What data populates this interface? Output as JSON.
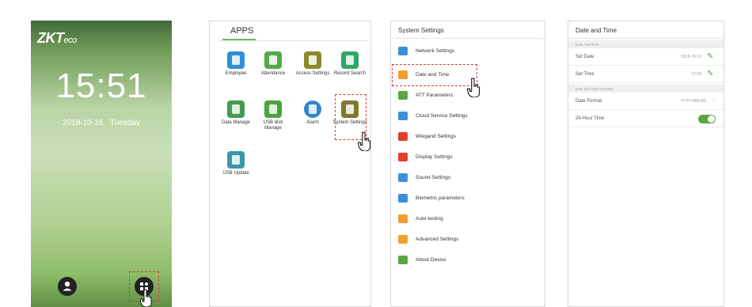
{
  "lock_screen": {
    "logo_main": "ZKT",
    "logo_sub": "eco",
    "time": "15:51",
    "date": "2018-10-16",
    "weekday": "Tuesday",
    "user_button_icon": "user-icon",
    "apps_button_icon": "apps-grid-icon"
  },
  "apps_screen": {
    "title": "APPS",
    "apps": [
      {
        "label": "Employee",
        "icon": "employee-icon",
        "color": "#2e8fd6"
      },
      {
        "label": "Attendance",
        "icon": "attendance-icon",
        "color": "#55a84a"
      },
      {
        "label": "Access Settings",
        "icon": "access-settings-icon",
        "color": "#8a8a2a"
      },
      {
        "label": "Record Search",
        "icon": "record-search-icon",
        "color": "#2fa66b"
      },
      {
        "label": "Data Manage",
        "icon": "data-manage-icon",
        "color": "#3f9e52"
      },
      {
        "label": "USB disk Manage",
        "icon": "usb-disk-icon",
        "color": "#4ea33e"
      },
      {
        "label": "Alarm",
        "icon": "alarm-icon",
        "color": "#2f86d0"
      },
      {
        "label": "System Settings",
        "icon": "gear-icon",
        "color": "#7e7a2c"
      },
      {
        "label": "USB Update",
        "icon": "usb-update-icon",
        "color": "#3b98a8"
      }
    ]
  },
  "settings_screen": {
    "title": "System Settings",
    "items": [
      {
        "label": "Network Settings",
        "icon": "network-icon",
        "color": "#3b8fd8"
      },
      {
        "label": "Date and Time",
        "icon": "calendar-icon",
        "color": "#f0a030"
      },
      {
        "label": "ATT Parameters",
        "icon": "att-icon",
        "color": "#5aa642"
      },
      {
        "label": "Cloud Service Settings",
        "icon": "cloud-icon",
        "color": "#3b8fd8"
      },
      {
        "label": "Wiegand Settings",
        "icon": "wiegand-icon",
        "color": "#e0402e"
      },
      {
        "label": "Display Settings",
        "icon": "display-icon",
        "color": "#e0402e"
      },
      {
        "label": "Sound Settings",
        "icon": "sound-icon",
        "color": "#3b8fd8"
      },
      {
        "label": "Biometric parameters",
        "icon": "biometric-icon",
        "color": "#3b8fd8"
      },
      {
        "label": "Auto-testing",
        "icon": "auto-test-icon",
        "color": "#f0a030"
      },
      {
        "label": "Advanced Settings",
        "icon": "advanced-icon",
        "color": "#f0a030"
      },
      {
        "label": "About Device",
        "icon": "about-icon",
        "color": "#5aa642"
      }
    ]
  },
  "datetime_screen": {
    "title": "Date and Time",
    "section1": "Date And Time",
    "set_date_label": "Set Date",
    "set_date_value": "2018-10-16",
    "set_time_label": "Set Time",
    "set_time_value": "17:58",
    "section2": "Date and Time Formats",
    "date_format_label": "Date Format",
    "date_format_value": "YYYY-MM-DD",
    "hour24_label": "24-Hour Time",
    "hour24_enabled": true
  }
}
